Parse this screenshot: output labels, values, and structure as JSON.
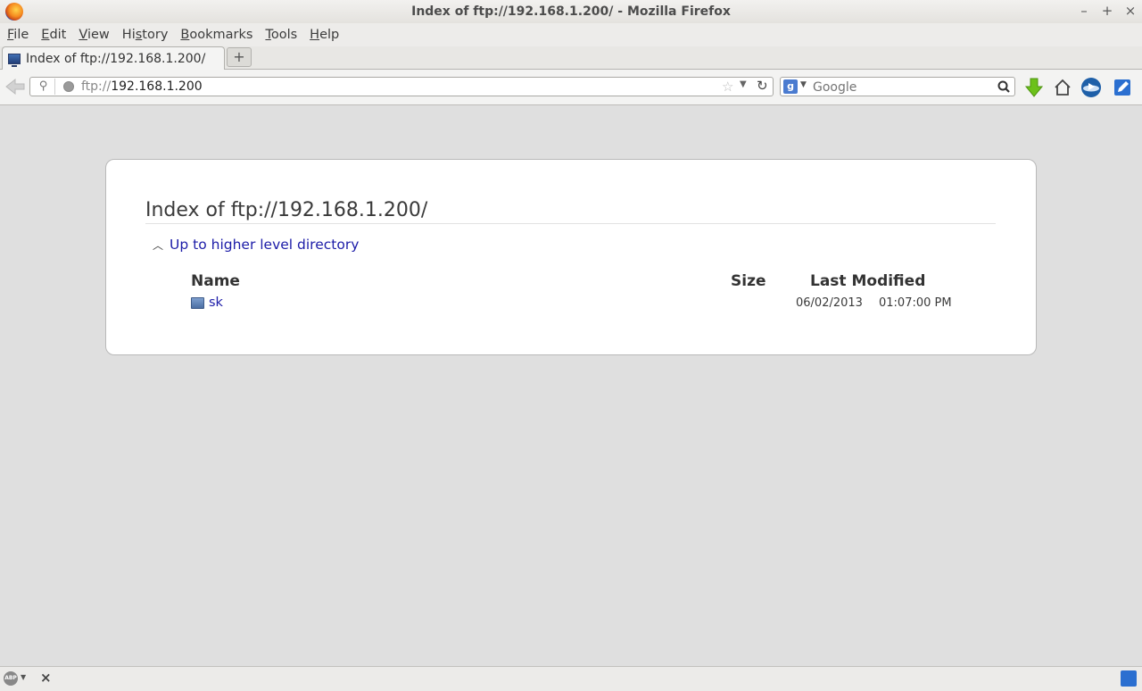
{
  "window": {
    "title": "Index of ftp://192.168.1.200/ - Mozilla Firefox",
    "controls": {
      "minimize": "–",
      "maximize": "+",
      "close": "×"
    }
  },
  "menubar": {
    "items": [
      {
        "label": "File",
        "mnemonic": "F",
        "rest": "ile"
      },
      {
        "label": "Edit",
        "mnemonic": "E",
        "rest": "dit"
      },
      {
        "label": "View",
        "mnemonic": "V",
        "rest": "iew"
      },
      {
        "label": "History",
        "pre": "Hi",
        "mnemonic": "s",
        "rest": "tory"
      },
      {
        "label": "Bookmarks",
        "mnemonic": "B",
        "rest": "ookmarks"
      },
      {
        "label": "Tools",
        "mnemonic": "T",
        "rest": "ools"
      },
      {
        "label": "Help",
        "mnemonic": "H",
        "rest": "elp"
      }
    ]
  },
  "tabs": {
    "active_label": "Index of ftp://192.168.1.200/",
    "new_tab_label": "+"
  },
  "navbar": {
    "url_protocol": "ftp://",
    "url_host": "192.168.1.200",
    "search_placeholder": "Google",
    "search_engine_letter": "g"
  },
  "listing": {
    "heading": "Index of ftp://192.168.1.200/",
    "up_link": "Up to higher level directory",
    "columns": {
      "name": "Name",
      "size": "Size",
      "modified": "Last Modified"
    },
    "rows": [
      {
        "name": "sk",
        "size": "",
        "date": "06/02/2013",
        "time": "01:07:00 PM"
      }
    ]
  },
  "statusbar": {
    "abp_label": "ABP",
    "close_label": "×"
  },
  "colors": {
    "link": "#1c1ca8",
    "page_bg": "#dfdfdf",
    "download_arrow": "#6cc11a"
  }
}
